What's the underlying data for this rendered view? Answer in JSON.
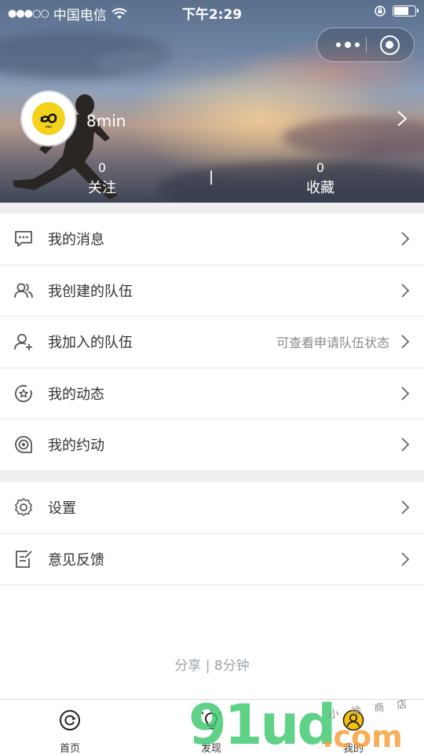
{
  "status_bar": {
    "signal_dots": "●●●○○",
    "carrier": "中国电信",
    "wifi_icon": "wifi-icon",
    "time": "下午2:29",
    "battery_level": 0.7
  },
  "profile": {
    "username": "8min",
    "stats": [
      {
        "value": "0",
        "label": "关注"
      },
      {
        "value": "0",
        "label": "收藏"
      }
    ]
  },
  "menu_group_1": [
    {
      "label": "我的消息",
      "icon": "message-icon",
      "hint": ""
    },
    {
      "label": "我创建的队伍",
      "icon": "team-icon",
      "hint": ""
    },
    {
      "label": "我加入的队伍",
      "icon": "add-user-icon",
      "hint": "可查看申请队伍状态"
    },
    {
      "label": "我的动态",
      "icon": "star-circle-icon",
      "hint": ""
    },
    {
      "label": "我的约动",
      "icon": "target-icon",
      "hint": ""
    }
  ],
  "menu_group_2": [
    {
      "label": "设置",
      "icon": "gear-icon",
      "hint": ""
    },
    {
      "label": "意见反馈",
      "icon": "feedback-icon",
      "hint": ""
    }
  ],
  "footer": "分享 | 8分钟",
  "tabbar": [
    {
      "label": "首页",
      "icon": "home-refresh-icon"
    },
    {
      "label": "发现",
      "icon": "lightbulb-icon"
    },
    {
      "label": "我的",
      "icon": "user-icon"
    }
  ],
  "watermark": {
    "main": "91ud",
    "suffix": ".com",
    "small": "小 徐 商 店"
  },
  "colors": {
    "avatar_brand": "#f4d21b",
    "tab_active": "#f4c20d",
    "watermark_green": "#3cc86e",
    "watermark_orange": "#f5a03c"
  }
}
